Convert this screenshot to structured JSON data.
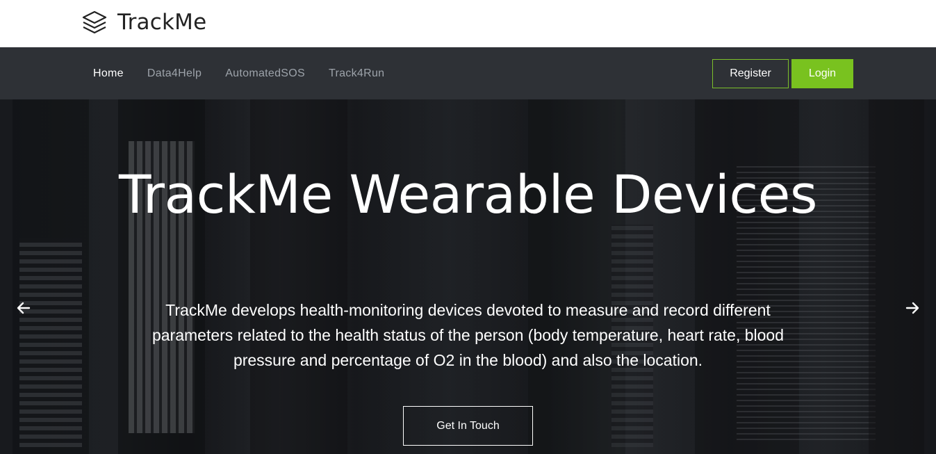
{
  "brand": {
    "name": "TrackMe",
    "icon": "layers-icon"
  },
  "nav": {
    "items": [
      {
        "label": "Home",
        "active": true
      },
      {
        "label": "Data4Help",
        "active": false
      },
      {
        "label": "AutomatedSOS",
        "active": false
      },
      {
        "label": "Track4Run",
        "active": false
      }
    ],
    "register_label": "Register",
    "login_label": "Login"
  },
  "hero": {
    "title": "TrackMe Wearable Devices",
    "description": "TrackMe develops health-monitoring devices devoted to measure and record different parameters related to the health status of the person (body temperature, heart rate, blood pressure and percentage of O2 in the blood) and also the location.",
    "cta_label": "Get In Touch",
    "prev_icon": "arrow-left-icon",
    "next_icon": "arrow-right-icon"
  },
  "colors": {
    "accent": "#79c21f",
    "navbar_bg": "#2e3136",
    "nav_inactive": "#9da3aa"
  }
}
